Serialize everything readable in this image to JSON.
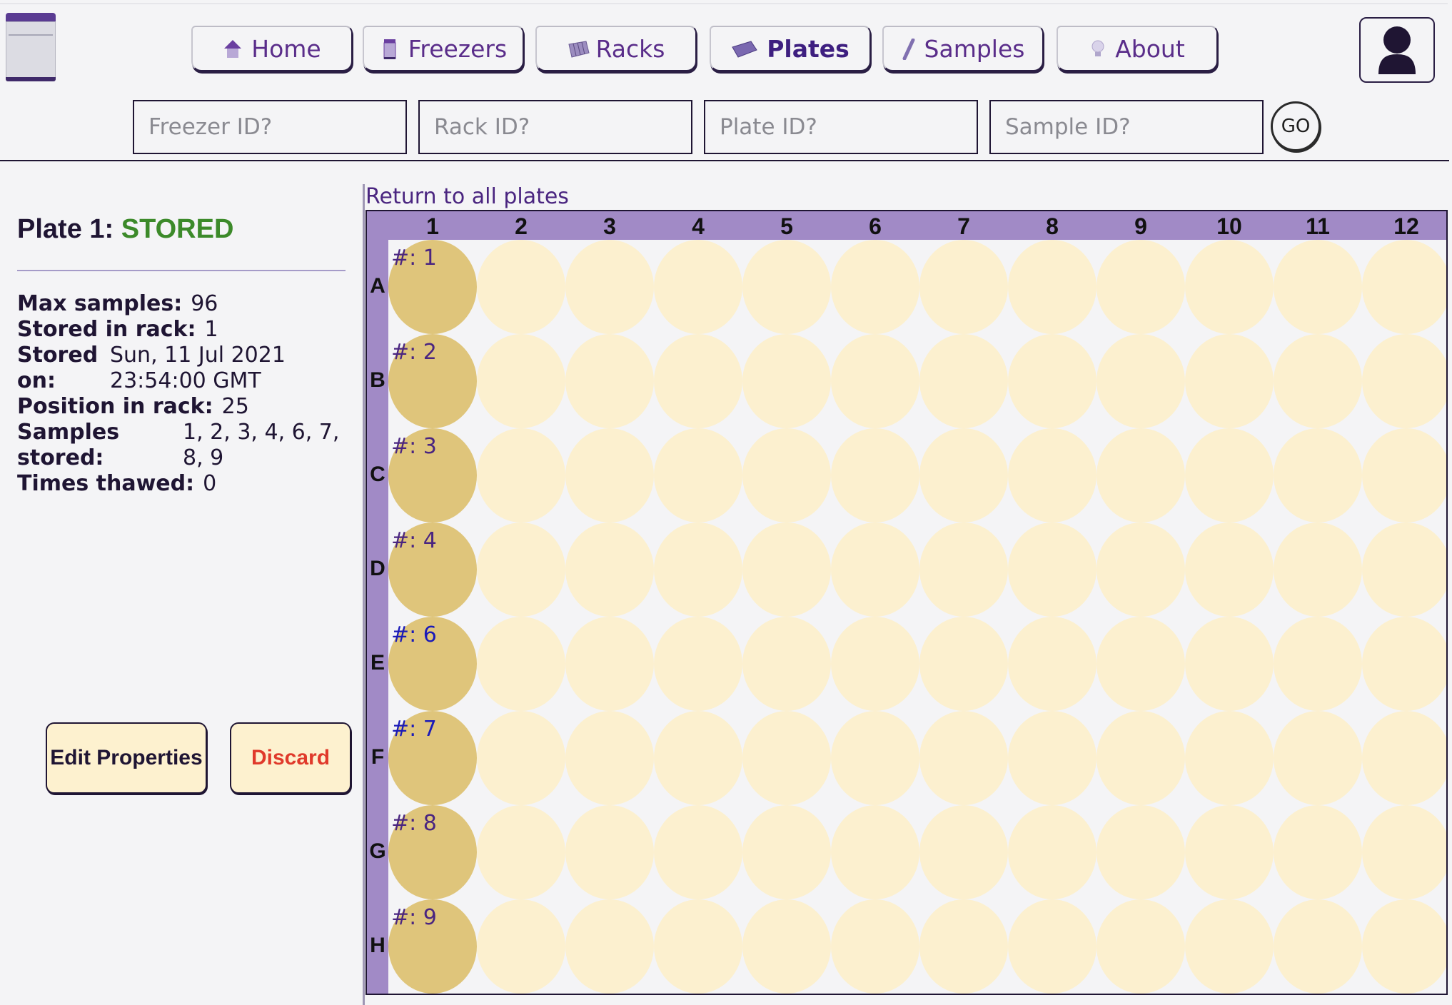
{
  "nav": {
    "tabs": [
      {
        "label": "Home",
        "icon": "house-icon",
        "active": false
      },
      {
        "label": "Freezers",
        "icon": "freezer-icon",
        "active": false
      },
      {
        "label": "Racks",
        "icon": "rack-icon",
        "active": false
      },
      {
        "label": "Plates",
        "icon": "plate-icon",
        "active": true
      },
      {
        "label": "Samples",
        "icon": "tube-icon",
        "active": false
      },
      {
        "label": "About",
        "icon": "lightbulb-icon",
        "active": false
      }
    ]
  },
  "filters": {
    "freezer_placeholder": "Freezer ID?",
    "rack_placeholder": "Rack ID?",
    "plate_placeholder": "Plate ID?",
    "sample_placeholder": "Sample ID?",
    "go_label": "GO"
  },
  "plate": {
    "title_prefix": "Plate 1:",
    "status": "STORED",
    "props": {
      "max_samples_label": "Max samples:",
      "max_samples": "96",
      "stored_in_rack_label": "Stored in rack:",
      "stored_in_rack": "1",
      "stored_on_label": "Stored on:",
      "stored_on": "Sun, 11 Jul 2021 23:54:00 GMT",
      "position_label": "Position in rack:",
      "position": "25",
      "samples_label": "Samples stored:",
      "samples": "1, 2, 3, 4, 6, 7, 8, 9",
      "thawed_label": "Times thawed:",
      "thawed": "0"
    },
    "edit_label": "Edit Properties",
    "discard_label": "Discard"
  },
  "grid": {
    "return_link": "Return to all plates",
    "columns": [
      "1",
      "2",
      "3",
      "4",
      "5",
      "6",
      "7",
      "8",
      "9",
      "10",
      "11",
      "12"
    ],
    "rows": [
      "A",
      "B",
      "C",
      "D",
      "E",
      "F",
      "G",
      "H"
    ],
    "filled_wells": [
      {
        "row": "A",
        "col": "1",
        "label": "#: 1",
        "color": "#4a2580"
      },
      {
        "row": "B",
        "col": "1",
        "label": "#: 2",
        "color": "#4a2580"
      },
      {
        "row": "C",
        "col": "1",
        "label": "#: 3",
        "color": "#4a2580"
      },
      {
        "row": "D",
        "col": "1",
        "label": "#: 4",
        "color": "#4a2580"
      },
      {
        "row": "E",
        "col": "1",
        "label": "#: 6",
        "color": "#1a1ab8"
      },
      {
        "row": "F",
        "col": "1",
        "label": "#: 7",
        "color": "#1a1ab8"
      },
      {
        "row": "G",
        "col": "1",
        "label": "#: 8",
        "color": "#4a2580"
      },
      {
        "row": "H",
        "col": "1",
        "label": "#: 9",
        "color": "#4a2580"
      }
    ],
    "colors": {
      "header": "#a18ac6",
      "well_empty": "#fcf0cf",
      "well_filled": "#dfc57b"
    }
  },
  "colors": {
    "accent": "#5a2d8a",
    "status_ok": "#3c8a2a",
    "danger": "#e03a2b"
  }
}
